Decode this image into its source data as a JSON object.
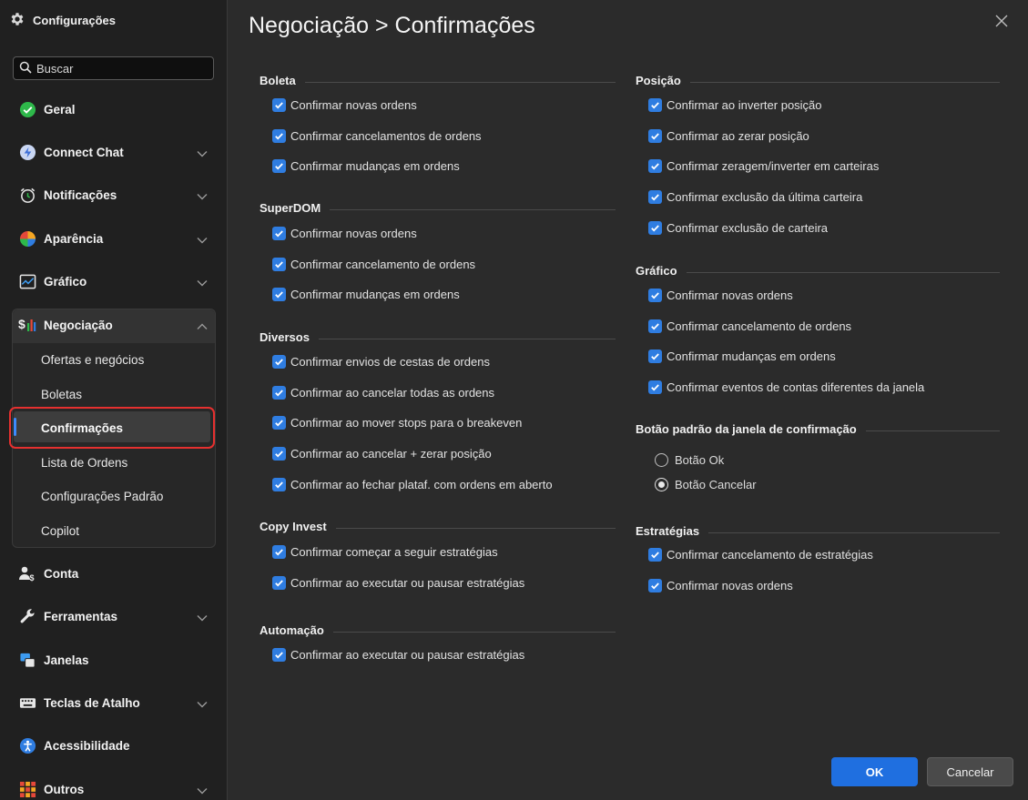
{
  "sidebar": {
    "header": "Configurações",
    "search_placeholder": "Buscar",
    "items": [
      {
        "label": "Geral"
      },
      {
        "label": "Connect Chat"
      },
      {
        "label": "Notificações"
      },
      {
        "label": "Aparência"
      },
      {
        "label": "Gráfico"
      },
      {
        "label": "Negociação"
      },
      {
        "label": "Conta"
      },
      {
        "label": "Ferramentas"
      },
      {
        "label": "Janelas"
      },
      {
        "label": "Teclas de Atalho"
      },
      {
        "label": "Acessibilidade"
      },
      {
        "label": "Outros"
      }
    ],
    "negociacao_sub": [
      "Ofertas e negócios",
      "Boletas",
      "Confirmações",
      "Lista de Ordens",
      "Configurações Padrão",
      "Copilot"
    ],
    "active_sub": "Confirmações"
  },
  "main": {
    "title": "Negociação > Confirmações",
    "sections": {
      "boleta": {
        "title": "Boleta",
        "items": [
          "Confirmar novas ordens",
          "Confirmar cancelamentos de ordens",
          "Confirmar mudanças em ordens"
        ]
      },
      "superdom": {
        "title": "SuperDOM",
        "items": [
          "Confirmar novas ordens",
          "Confirmar cancelamento de ordens",
          "Confirmar mudanças em ordens"
        ]
      },
      "diversos": {
        "title": "Diversos",
        "items": [
          "Confirmar envios de cestas de ordens",
          "Confirmar ao cancelar todas as ordens",
          "Confirmar ao mover stops para o breakeven",
          "Confirmar ao cancelar + zerar posição",
          "Confirmar ao fechar plataf. com ordens em aberto"
        ]
      },
      "copy_invest": {
        "title": "Copy Invest",
        "items": [
          "Confirmar começar a seguir estratégias",
          "Confirmar ao executar ou pausar estratégias"
        ]
      },
      "automacao": {
        "title": "Automação",
        "items": [
          "Confirmar ao executar ou pausar estratégias"
        ]
      },
      "posicao": {
        "title": "Posição",
        "items": [
          "Confirmar ao inverter posição",
          "Confirmar ao zerar posição",
          "Confirmar zeragem/inverter em carteiras",
          "Confirmar exclusão da última carteira",
          "Confirmar exclusão de carteira"
        ]
      },
      "grafico": {
        "title": "Gráfico",
        "items": [
          "Confirmar novas ordens",
          "Confirmar cancelamento de ordens",
          "Confirmar mudanças em ordens",
          "Confirmar eventos de contas diferentes da janela"
        ]
      },
      "botao_padrao": {
        "title": "Botão padrão da janela de confirmação",
        "options": [
          "Botão Ok",
          "Botão Cancelar"
        ],
        "selected": "Botão Cancelar"
      },
      "estrategias": {
        "title": "Estratégias",
        "items": [
          "Confirmar cancelamento de estratégias",
          "Confirmar novas ordens"
        ]
      }
    }
  },
  "footer": {
    "ok_label": "OK",
    "cancel_label": "Cancelar"
  },
  "colors": {
    "accent": "#1f6fe0",
    "checkbox": "#2f7de1",
    "highlight": "#e5302f",
    "background": "#2b2b2b",
    "sidebar": "#202020"
  }
}
